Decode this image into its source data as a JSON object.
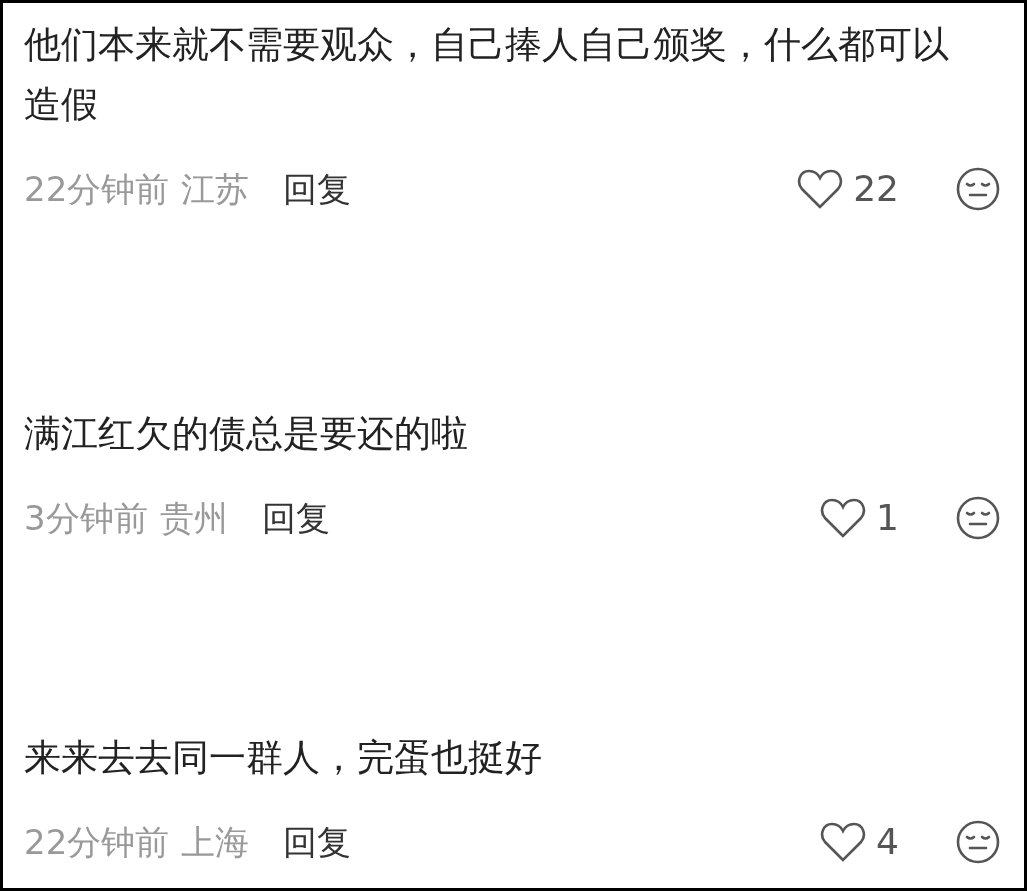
{
  "comments": [
    {
      "text": "他们本来就不需要观众，自己捧人自己颁奖，什么都可以造假",
      "time": "22分钟前",
      "location": "江苏",
      "reply": "回复",
      "likes": "22"
    },
    {
      "text": "满江红欠的债总是要还的啦",
      "time": "3分钟前",
      "location": "贵州",
      "reply": "回复",
      "likes": "1"
    },
    {
      "text": "来来去去同一群人，完蛋也挺好",
      "time": "22分钟前",
      "location": "上海",
      "reply": "回复",
      "likes": "4"
    }
  ]
}
